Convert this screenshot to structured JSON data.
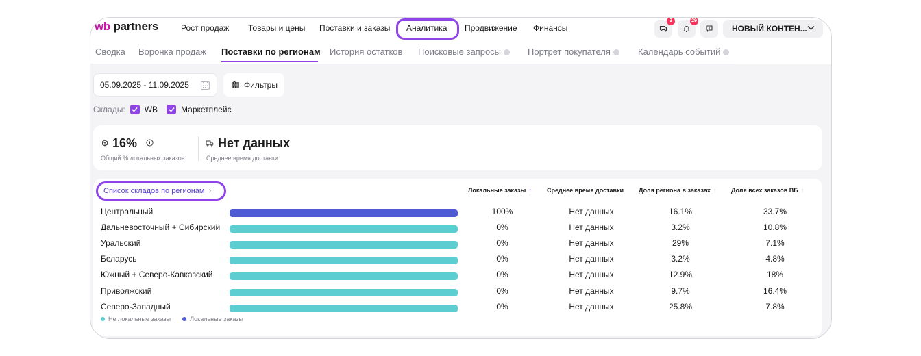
{
  "brand": {
    "logo_wb": "wb",
    "logo_partners": "partners",
    "colors": {
      "brand": "#cb11ab",
      "accent": "#8e44e6",
      "local": "#4f5bd5",
      "nonlocal": "#5ccdd0"
    }
  },
  "nav": {
    "items": [
      {
        "label": "Рост продаж"
      },
      {
        "label": "Товары и цены"
      },
      {
        "label": "Поставки и заказы"
      },
      {
        "label": "Аналитика",
        "active": true
      },
      {
        "label": "Продвижение"
      },
      {
        "label": "Финансы"
      }
    ]
  },
  "header": {
    "chat_badge": "3",
    "notifications_badge": "29",
    "chat_icon": "chat-icon",
    "bell_icon": "bell-icon",
    "feedback_icon": "feedback-icon",
    "account_name": "НОВЫЙ КОНТЕН..."
  },
  "tabs": [
    {
      "label": "Сводка"
    },
    {
      "label": "Воронка продаж"
    },
    {
      "label": "Поставки по регионам",
      "active": true
    },
    {
      "label": "История остатков"
    },
    {
      "label": "Поисковые запросы"
    },
    {
      "label": "Портрет покупателя"
    },
    {
      "label": "Календарь событий"
    }
  ],
  "filters": {
    "date_range": "05.09.2025 - 11.09.2025",
    "filters_label": "Фильтры",
    "warehouses_label": "Склады:",
    "warehouse_options": [
      {
        "label": "WB",
        "checked": true
      },
      {
        "label": "Маркетплейс",
        "checked": true
      }
    ]
  },
  "summary": {
    "local_share_value": "16%",
    "local_share_label": "Общий % локальных заказов",
    "delivery_value": "Нет данных",
    "delivery_label": "Среднее время доставки"
  },
  "table": {
    "list_link": "Список складов по регионам",
    "headers": {
      "local_orders": "Локальные заказы",
      "avg_delivery": "Среднее время доставки",
      "region_share": "Доля региона в заказах",
      "all_share": "Доля всех заказов ВБ"
    },
    "rows": [
      {
        "region": "Центральный",
        "local": "100%",
        "local_fraction": 1.0,
        "delivery": "Нет данных",
        "region_share": "16.1%",
        "all_share": "33.7%"
      },
      {
        "region": "Дальневосточный + Сибирский",
        "local": "0%",
        "local_fraction": 0.0,
        "delivery": "Нет данных",
        "region_share": "3.2%",
        "all_share": "10.8%"
      },
      {
        "region": "Уральский",
        "local": "0%",
        "local_fraction": 0.0,
        "delivery": "Нет данных",
        "region_share": "29%",
        "all_share": "7.1%"
      },
      {
        "region": "Беларусь",
        "local": "0%",
        "local_fraction": 0.0,
        "delivery": "Нет данных",
        "region_share": "3.2%",
        "all_share": "4.8%"
      },
      {
        "region": "Южный + Северо-Кавказский",
        "local": "0%",
        "local_fraction": 0.0,
        "delivery": "Нет данных",
        "region_share": "12.9%",
        "all_share": "18%"
      },
      {
        "region": "Приволжский",
        "local": "0%",
        "local_fraction": 0.0,
        "delivery": "Нет данных",
        "region_share": "9.7%",
        "all_share": "16.4%"
      },
      {
        "region": "Северо-Западный",
        "local": "0%",
        "local_fraction": 0.0,
        "delivery": "Нет данных",
        "region_share": "25.8%",
        "all_share": "7.8%"
      }
    ],
    "legend": {
      "nonlocal": "Не локальные заказы",
      "local": "Локальные заказы"
    }
  }
}
